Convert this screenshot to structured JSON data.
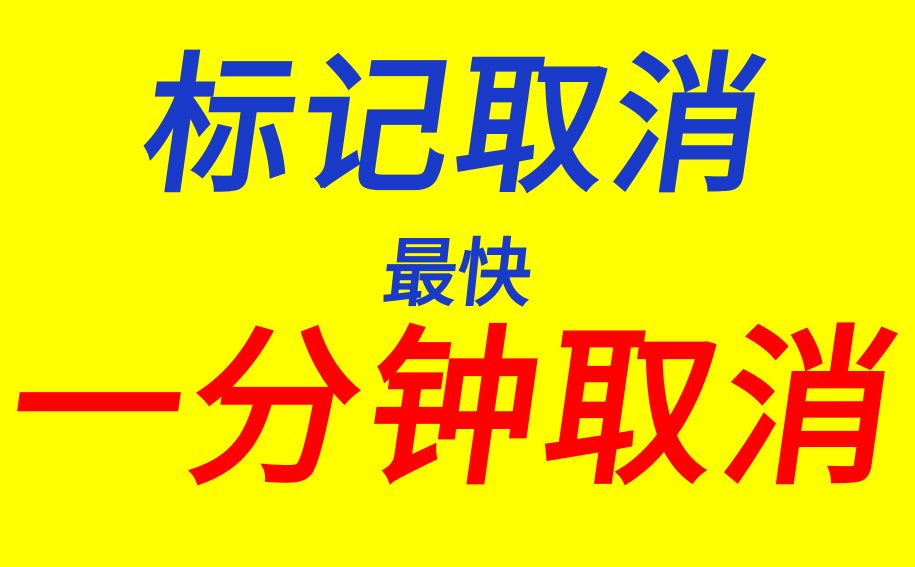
{
  "banner": {
    "line1": "标记取消",
    "line2": "最快",
    "line3": "一分钟取消",
    "colors": {
      "background": "#FFFF00",
      "line1": "#1A3BC9",
      "line2": "#1A3BC9",
      "line3": "#FF0000"
    }
  }
}
